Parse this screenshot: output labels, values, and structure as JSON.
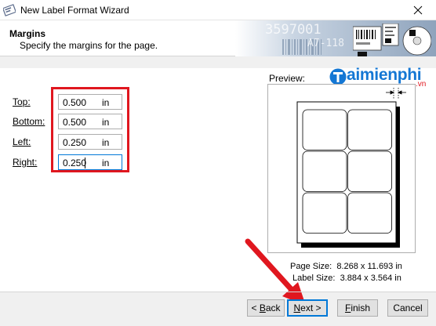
{
  "window": {
    "title": "New Label Format Wizard"
  },
  "header": {
    "title": "Margins",
    "subtitle": "Specify the margins for the page.",
    "graphic_text_1": "3597001",
    "graphic_text_2": "A7-118"
  },
  "fields": [
    {
      "label": "Top:",
      "value": "0.500",
      "unit": "in"
    },
    {
      "label": "Bottom:",
      "value": "0.500",
      "unit": "in"
    },
    {
      "label": "Left:",
      "value": "0.250",
      "unit": "in"
    },
    {
      "label": "Right:",
      "value": "0.250",
      "unit": "in"
    }
  ],
  "preview": {
    "label": "Preview:",
    "page_size_label": "Page Size:",
    "page_size_value": "8.268 x 11.693 in",
    "label_size_label": "Label Size:",
    "label_size_value": "3.884 x 3.564 in",
    "label_rows": 3,
    "label_cols": 2
  },
  "watermark": {
    "text": "aimienphi",
    "suffix": ".vn"
  },
  "buttons": {
    "back": "< Back",
    "next": "Next >",
    "finish": "Finish",
    "cancel": "Cancel"
  },
  "colors": {
    "highlight": "#e0171f",
    "focus": "#0078d7"
  }
}
